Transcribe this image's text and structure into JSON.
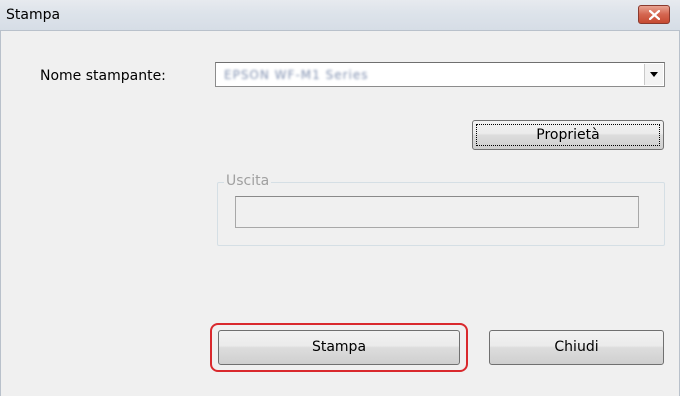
{
  "window": {
    "title": "Stampa"
  },
  "printer": {
    "label": "Nome stampante:",
    "selected_value": "EPSON WF-M1 Series"
  },
  "buttons": {
    "properties_label": "Proprietà",
    "print_label": "Stampa",
    "close_label": "Chiudi"
  },
  "output_group": {
    "label": "Uscita",
    "value": ""
  },
  "colors": {
    "highlight": "#d9292d",
    "close_button": "#c64a32"
  },
  "icons": {
    "close": "close-icon",
    "dropdown": "chevron-down-icon"
  }
}
